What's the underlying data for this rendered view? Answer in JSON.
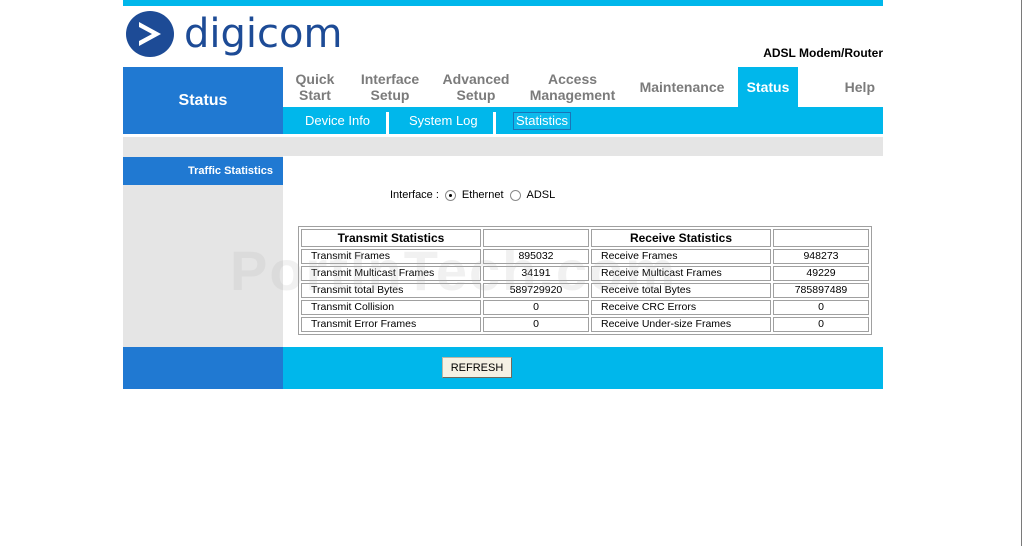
{
  "brand": {
    "name": "digicom",
    "product": "ADSL Modem/Router"
  },
  "nav": {
    "section_title": "Status",
    "tabs": [
      {
        "label": "Quick\nStart"
      },
      {
        "label": "Interface\nSetup"
      },
      {
        "label": "Advanced\nSetup"
      },
      {
        "label": "Access\nManagement"
      },
      {
        "label": "Maintenance"
      },
      {
        "label": "Status"
      },
      {
        "label": "Help"
      }
    ]
  },
  "subnav": [
    {
      "label": "Device Info"
    },
    {
      "label": "System Log"
    },
    {
      "label": "Statistics"
    }
  ],
  "sidebar": {
    "label": "Traffic Statistics"
  },
  "interface": {
    "label": "Interface :",
    "options": [
      {
        "label": "Ethernet",
        "checked": true
      },
      {
        "label": "ADSL",
        "checked": false
      }
    ]
  },
  "stats": {
    "transmit_header": "Transmit Statistics",
    "receive_header": "Receive Statistics",
    "rows": [
      {
        "tx_label": "Transmit Frames",
        "tx_value": "895032",
        "rx_label": "Receive Frames",
        "rx_value": "948273"
      },
      {
        "tx_label": "Transmit Multicast Frames",
        "tx_value": "34191",
        "rx_label": "Receive Multicast Frames",
        "rx_value": "49229"
      },
      {
        "tx_label": "Transmit total Bytes",
        "tx_value": "589729920",
        "rx_label": "Receive total Bytes",
        "rx_value": "785897489"
      },
      {
        "tx_label": "Transmit Collision",
        "tx_value": "0",
        "rx_label": "Receive CRC Errors",
        "rx_value": "0"
      },
      {
        "tx_label": "Transmit Error Frames",
        "tx_value": "0",
        "rx_label": "Receive Under-size Frames",
        "rx_value": "0"
      }
    ]
  },
  "actions": {
    "refresh_label": "REFRESH"
  },
  "watermark": "PortInTech.com",
  "colors": {
    "accent": "#00b7eb",
    "brand_blue": "#2079d2",
    "logo_blue": "#1d4b96",
    "panel_grey": "#e5e5e5"
  }
}
